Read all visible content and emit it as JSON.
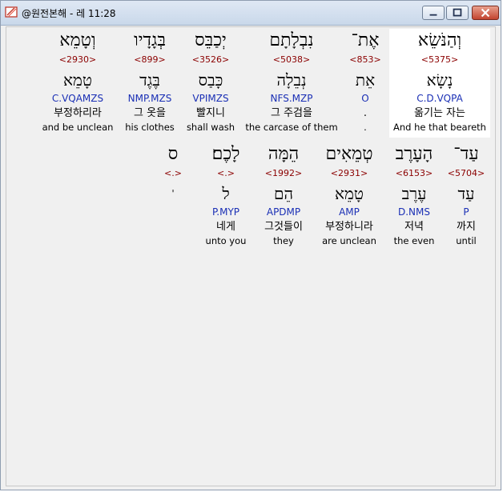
{
  "window": {
    "title": "@원전본해 - 레 11:28",
    "icons": {
      "app": "book-icon",
      "minimize": "minimize-icon",
      "maximize": "maximize-icon",
      "close": "close-icon"
    },
    "colors": {
      "strong": "#8b0000",
      "morph": "#1a2fb5",
      "highlight": "#ffffff"
    }
  },
  "verse": {
    "row1": [
      {
        "heb": "וְהַנֹּשֵׂא",
        "strong": "<5375>",
        "lemma": "נָשָׂא",
        "morph": "C.D.VQPA",
        "kor": "옮기는 자는",
        "eng": "And he that beareth"
      },
      {
        "heb": "אֶת־",
        "strong": "<853>",
        "lemma": "אֵת",
        "morph": "O",
        "kor": ".",
        "eng": "."
      },
      {
        "heb": "נִבְלָתָם",
        "strong": "<5038>",
        "lemma": "נְבֵלָה",
        "morph": "NFS.MZP",
        "kor": "그 주검을",
        "eng": "the carcase of them"
      },
      {
        "heb": "יְכַבֵּס",
        "strong": "<3526>",
        "lemma": "כָּבַס",
        "morph": "VPIMZS",
        "kor": "빨지니",
        "eng": "shall wash"
      },
      {
        "heb": "בְּגָדָיו",
        "strong": "<899>",
        "lemma": "בֶּגֶד",
        "morph": "NMP.MZS",
        "kor": "그 옷을",
        "eng": "his clothes"
      },
      {
        "heb": "וְטָמֵא",
        "strong": "<2930>",
        "lemma": "טָמֵא",
        "morph": "C.VQAMZS",
        "kor": "부정하리라",
        "eng": "and be unclean"
      }
    ],
    "row2": [
      {
        "heb": "עַד־",
        "strong": "<5704>",
        "lemma": "עַד",
        "morph": "P",
        "kor": "까지",
        "eng": "until"
      },
      {
        "heb": "הָעָרֶב",
        "strong": "<6153>",
        "lemma": "עֶרֶב",
        "morph": "D.NMS",
        "kor": "저녁",
        "eng": "the even"
      },
      {
        "heb": "טְמֵאִים",
        "strong": "<2931>",
        "lemma": "טָמֵא",
        "morph": "AMP",
        "kor": "부정하니라",
        "eng": "are unclean"
      },
      {
        "heb": "הֵמָּה",
        "strong": "<1992>",
        "lemma": "הֵם",
        "morph": "APDMP",
        "kor": "그것들이",
        "eng": "they"
      },
      {
        "heb": "לָכֶם׃",
        "strong": "<.>",
        "lemma": "ל",
        "morph": "P.MYP",
        "kor": "네게",
        "eng": "unto you"
      },
      {
        "heb": "ס",
        "strong": "<.>",
        "lemma": "'",
        "morph": "",
        "kor": "",
        "eng": ""
      }
    ]
  }
}
